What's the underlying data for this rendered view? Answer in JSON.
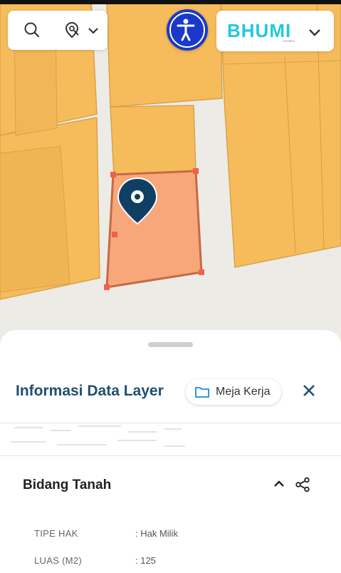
{
  "map": {
    "colors": {
      "parcel": "#f6bc5c",
      "parcel_border": "#d9a248",
      "selected": "#f8a77a",
      "selected_border": "#c56a43",
      "road": "#ecebe6",
      "marker": "#0f3f63"
    },
    "icons": [
      "search-icon",
      "location-search-icon",
      "chevron-down-icon",
      "accessibility-icon",
      "map-marker-icon"
    ]
  },
  "header": {
    "logo_text": "BHUMI",
    "logo_sub": "ATR/BPN"
  },
  "panel": {
    "title": "Informasi Data Layer",
    "workspace_label": "Meja Kerja",
    "section_title": "Bidang Tanah",
    "rows": [
      {
        "label": "TIPE HAK",
        "value": ": Hak Milik"
      },
      {
        "label": "LUAS (M2)",
        "value": ": 125"
      }
    ],
    "accent_color": "#1f4f73"
  }
}
